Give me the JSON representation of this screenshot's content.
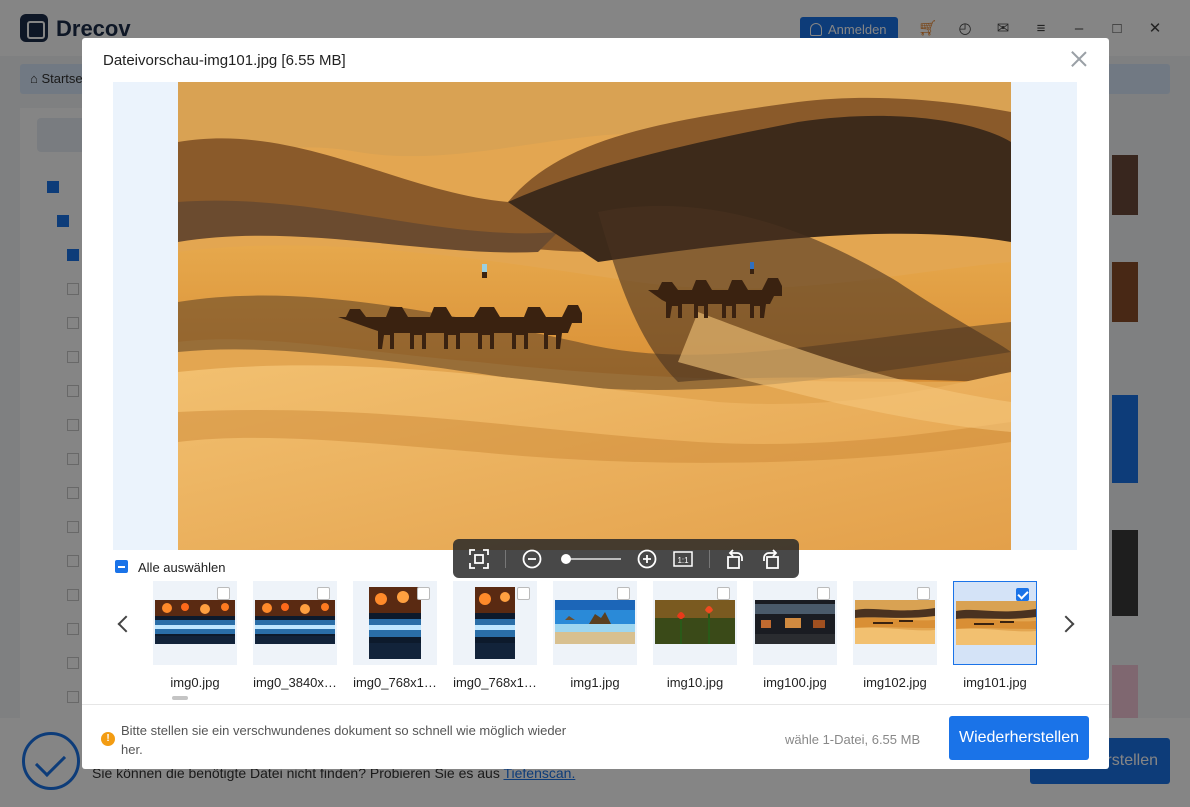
{
  "app": {
    "name": "Drecov",
    "login_label": "Anmelden",
    "breadcrumb": "Startseite",
    "hint_text": "Sie können die benötigte Datei nicht finden? Probieren Sie es aus",
    "hint_link": "Tiefenscan.",
    "recover_label": "Wiederherstellen"
  },
  "modal": {
    "title": "Dateivorschau-img101.jpg [6.55 MB]",
    "select_all_label": "Alle auswählen",
    "zoom_level": 0.05,
    "toolbar_icons": [
      "fit-screen-icon",
      "zoom-out-icon",
      "zoom-in-icon",
      "actual-size-icon",
      "rotate-left-icon",
      "rotate-right-icon"
    ],
    "actual_size_label": "1:1",
    "thumbnails": [
      {
        "name": "img0.jpg",
        "checked": false,
        "kind": "tech"
      },
      {
        "name": "img0_3840x…",
        "checked": false,
        "kind": "tech"
      },
      {
        "name": "img0_768x1…",
        "checked": false,
        "kind": "tech-portrait"
      },
      {
        "name": "img0_768x1…",
        "checked": false,
        "kind": "tech-tall"
      },
      {
        "name": "img1.jpg",
        "checked": false,
        "kind": "beach"
      },
      {
        "name": "img10.jpg",
        "checked": false,
        "kind": "flowers"
      },
      {
        "name": "img100.jpg",
        "checked": false,
        "kind": "night"
      },
      {
        "name": "img102.jpg",
        "checked": false,
        "kind": "desert"
      },
      {
        "name": "img101.jpg",
        "checked": true,
        "kind": "desert"
      }
    ],
    "warning": "Bitte stellen sie ein verschwundenes dokument so schnell wie möglich wieder her.",
    "selection_info": "wähle 1-Datei, 6.55 MB",
    "recover_label": "Wiederherstellen"
  },
  "colors": {
    "accent": "#1a73e8",
    "warning": "#f39c12"
  }
}
